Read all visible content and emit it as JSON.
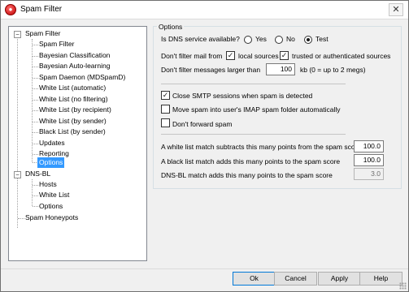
{
  "window": {
    "title": "Spam Filter",
    "close_glyph": "✕"
  },
  "tree": {
    "root": "Spam Filter",
    "spam_children": [
      "Spam Filter",
      "Bayesian Classification",
      "Bayesian Auto-learning",
      "Spam Daemon (MDSpamD)",
      "White List (automatic)",
      "White List (no filtering)",
      "White List (by recipient)",
      "White List (by sender)",
      "Black List (by sender)",
      "Updates",
      "Reporting",
      "Options"
    ],
    "selected": "Options",
    "dnsbl": "DNS-BL",
    "dnsbl_children": [
      "Hosts",
      "White List",
      "Options"
    ],
    "honeypots": "Spam Honeypots"
  },
  "options": {
    "group_title": "Options",
    "dns_question": "Is DNS service available?",
    "dns_choices": [
      {
        "label": "Yes",
        "checked": false
      },
      {
        "label": "No",
        "checked": false
      },
      {
        "label": "Test",
        "checked": true
      }
    ],
    "dont_filter_from": "Don't filter mail from",
    "local_sources": {
      "label": "local sources",
      "checked": true
    },
    "trusted_sources": {
      "label": "trusted or authenticated sources",
      "checked": true
    },
    "larger_than_label": "Don't filter messages larger than",
    "larger_than_value": "100",
    "larger_than_suffix": "kb (0 = up to 2 megs)",
    "close_smtp": {
      "label": "Close SMTP sessions when spam is detected",
      "checked": true
    },
    "move_imap": {
      "label": "Move spam into user's IMAP spam folder automatically",
      "checked": false
    },
    "dont_forward": {
      "label": "Don't forward spam",
      "checked": false
    },
    "whitelist_label": "A white list match subtracts this many points from the spam score",
    "whitelist_value": "100.0",
    "blacklist_label": "A black list match adds this many points to the spam score",
    "blacklist_value": "100.0",
    "dnsbl_label": "DNS-BL match adds this many points to the spam score",
    "dnsbl_value": "3.0"
  },
  "buttons": {
    "ok": "Ok",
    "cancel": "Cancel",
    "apply": "Apply",
    "help": "Help"
  },
  "check_glyph": "✓"
}
